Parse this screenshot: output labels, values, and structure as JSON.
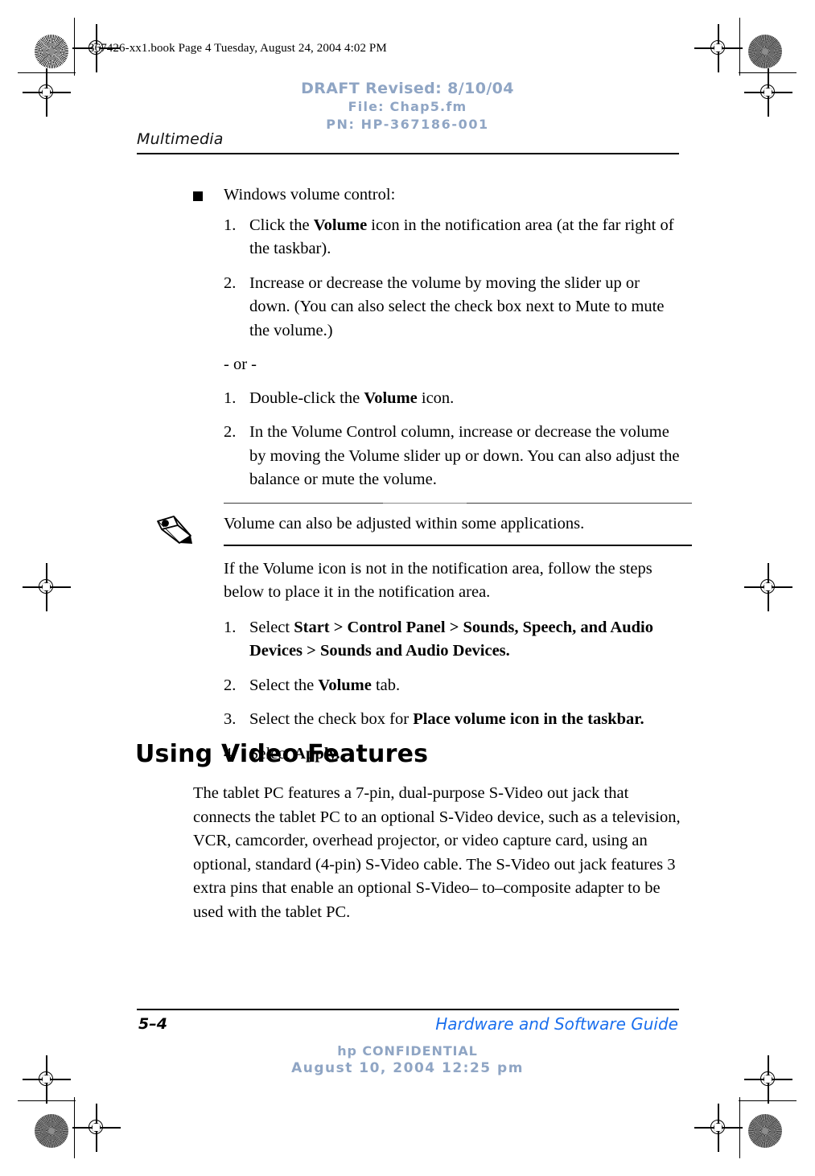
{
  "stamp": {
    "book_line": "367426-xx1.book  Page 4  Tuesday, August 24, 2004  4:02 PM"
  },
  "draft": {
    "revised": "DRAFT Revised: 8/10/04",
    "file": "File: Chap5.fm",
    "pn": "PN: HP-367186-001"
  },
  "running_head": {
    "chapter": "Multimedia"
  },
  "content": {
    "bullet_intro": "Windows volume control:",
    "steps_a": [
      {
        "num": "1.",
        "parts": [
          {
            "t": "Click the ",
            "b": false
          },
          {
            "t": "Volume",
            "b": true
          },
          {
            "t": " icon in the notification area (at the far right of the taskbar).",
            "b": false
          }
        ]
      },
      {
        "num": "2.",
        "parts": [
          {
            "t": "Increase or decrease the volume by moving the slider up or down. (You can also select the check box next to Mute to mute the volume.)",
            "b": false
          }
        ]
      }
    ],
    "or_separator": "- or -",
    "steps_b": [
      {
        "num": "1.",
        "parts": [
          {
            "t": "Double-click the ",
            "b": false
          },
          {
            "t": "Volume",
            "b": true
          },
          {
            "t": " icon.",
            "b": false
          }
        ]
      },
      {
        "num": "2.",
        "parts": [
          {
            "t": "In the Volume Control column, increase or decrease the volume by moving the Volume slider up or down. You can also adjust the balance or mute the volume.",
            "b": false
          }
        ]
      }
    ],
    "note": {
      "icon": "pencil-icon",
      "text": "Volume can also be adjusted within some applications."
    },
    "notification_para": "If the Volume icon is not in the notification area, follow the steps below to place it in the notification area.",
    "steps_c": [
      {
        "num": "1.",
        "parts": [
          {
            "t": "Select ",
            "b": false
          },
          {
            "t": "Start > Control Panel > Sounds, Speech, and Audio Devices > Sounds and Audio Devices.",
            "b": true
          }
        ]
      },
      {
        "num": "2.",
        "parts": [
          {
            "t": "Select the ",
            "b": false
          },
          {
            "t": "Volume",
            "b": true
          },
          {
            "t": " tab.",
            "b": false
          }
        ]
      },
      {
        "num": "3.",
        "parts": [
          {
            "t": "Select the check box for ",
            "b": false
          },
          {
            "t": "Place volume icon in the taskbar.",
            "b": true
          }
        ]
      },
      {
        "num": "4.",
        "parts": [
          {
            "t": "Select ",
            "b": false
          },
          {
            "t": "Apply.",
            "b": true
          }
        ]
      }
    ],
    "section_heading": "Using Video Features",
    "video_para": "The tablet PC features a 7-pin, dual-purpose S-Video out jack that connects the tablet PC to an optional S-Video device, such as a television, VCR, camcorder, overhead projector, or video capture card, using an optional, standard (4-pin) S-Video cable. The S-Video out jack features 3 extra pins that enable an optional S-Video– to–composite adapter to be used with the tablet PC."
  },
  "footer": {
    "page_number": "5–4",
    "guide_title": "Hardware and Software Guide",
    "confidential": "hp CONFIDENTIAL",
    "confidential_date": "August 10, 2004 12:25 pm"
  },
  "colors": {
    "draft_blue_gray": "#8fa5c4",
    "guide_blue": "#1a6fee",
    "rule_black": "#000000"
  }
}
